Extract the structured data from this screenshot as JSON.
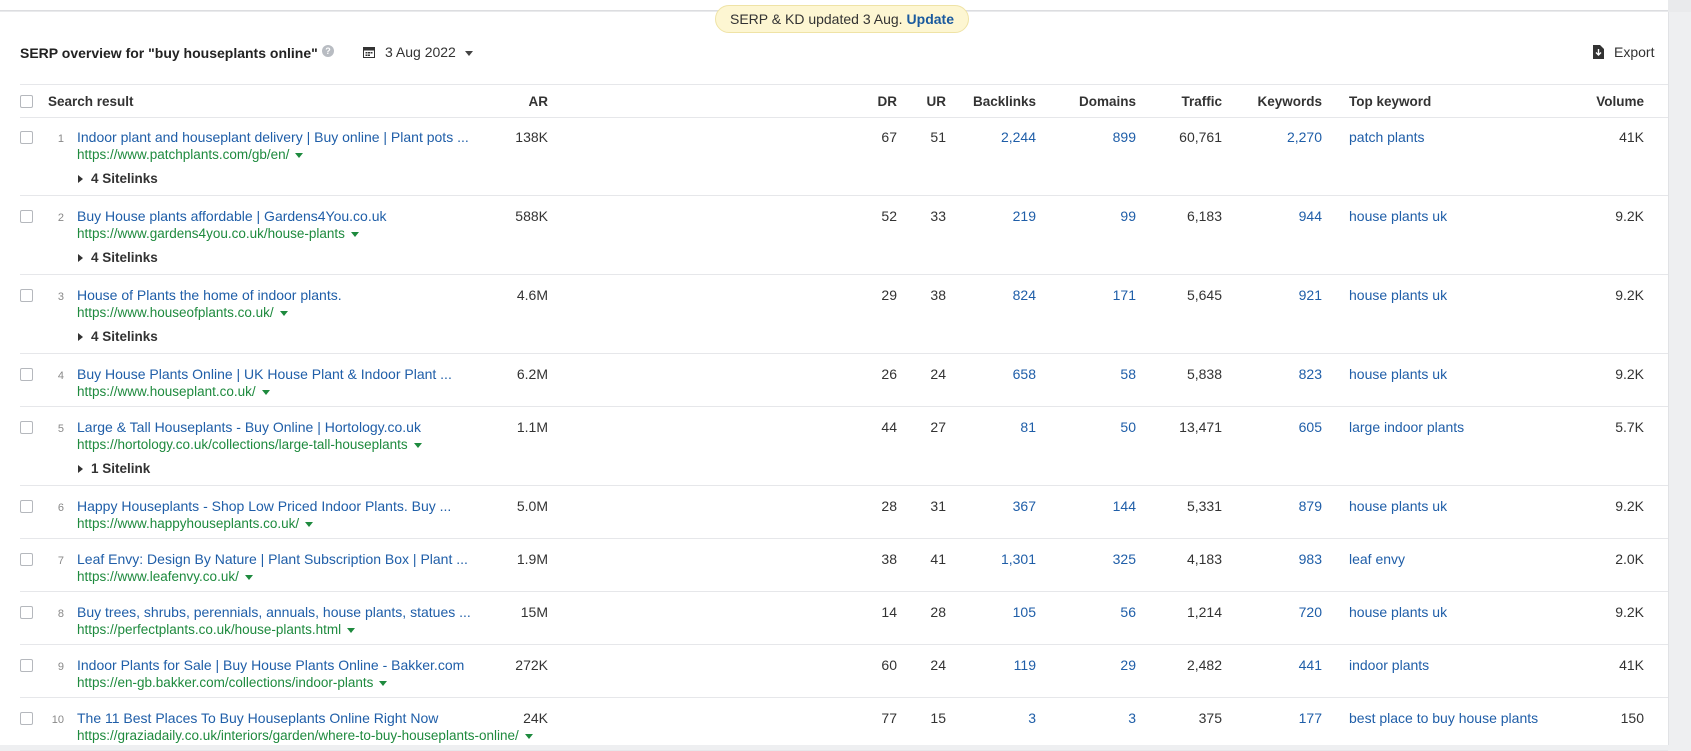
{
  "banner": {
    "text": "SERP & KD updated 3 Aug.",
    "link": "Update"
  },
  "header": {
    "title": "SERP overview for \"buy houseplants online\"",
    "date": "3 Aug 2022",
    "export": "Export"
  },
  "columns": {
    "search_result": "Search result",
    "ar": "AR",
    "dr": "DR",
    "ur": "UR",
    "backlinks": "Backlinks",
    "domains": "Domains",
    "traffic": "Traffic",
    "keywords": "Keywords",
    "top_keyword": "Top keyword",
    "volume": "Volume"
  },
  "rows": [
    {
      "idx": "1",
      "title": "Indoor plant and houseplant delivery | Buy online | Plant pots ...",
      "url": "https://www.patchplants.com/gb/en/",
      "sitelinks": "4 Sitelinks",
      "ar": "138K",
      "dr": "67",
      "ur": "51",
      "backlinks": "2,244",
      "domains": "899",
      "traffic": "60,761",
      "keywords": "2,270",
      "top_keyword": "patch plants",
      "volume": "41K"
    },
    {
      "idx": "2",
      "title": "Buy House plants affordable | Gardens4You.co.uk",
      "url": "https://www.gardens4you.co.uk/house-plants",
      "sitelinks": "4 Sitelinks",
      "ar": "588K",
      "dr": "52",
      "ur": "33",
      "backlinks": "219",
      "domains": "99",
      "traffic": "6,183",
      "keywords": "944",
      "top_keyword": "house plants uk",
      "volume": "9.2K"
    },
    {
      "idx": "3",
      "title": "House of Plants the home of indoor plants.",
      "url": "https://www.houseofplants.co.uk/",
      "sitelinks": "4 Sitelinks",
      "ar": "4.6M",
      "dr": "29",
      "ur": "38",
      "backlinks": "824",
      "domains": "171",
      "traffic": "5,645",
      "keywords": "921",
      "top_keyword": "house plants uk",
      "volume": "9.2K"
    },
    {
      "idx": "4",
      "title": "Buy House Plants Online | UK House Plant & Indoor Plant ...",
      "url": "https://www.houseplant.co.uk/",
      "sitelinks": "",
      "ar": "6.2M",
      "dr": "26",
      "ur": "24",
      "backlinks": "658",
      "domains": "58",
      "traffic": "5,838",
      "keywords": "823",
      "top_keyword": "house plants uk",
      "volume": "9.2K"
    },
    {
      "idx": "5",
      "title": "Large & Tall Houseplants - Buy Online | Hortology.co.uk",
      "url": "https://hortology.co.uk/collections/large-tall-houseplants",
      "sitelinks": "1 Sitelink",
      "ar": "1.1M",
      "dr": "44",
      "ur": "27",
      "backlinks": "81",
      "domains": "50",
      "traffic": "13,471",
      "keywords": "605",
      "top_keyword": "large indoor plants",
      "volume": "5.7K"
    },
    {
      "idx": "6",
      "title": "Happy Houseplants - Shop Low Priced Indoor Plants. Buy ...",
      "url": "https://www.happyhouseplants.co.uk/",
      "sitelinks": "",
      "ar": "5.0M",
      "dr": "28",
      "ur": "31",
      "backlinks": "367",
      "domains": "144",
      "traffic": "5,331",
      "keywords": "879",
      "top_keyword": "house plants uk",
      "volume": "9.2K"
    },
    {
      "idx": "7",
      "title": "Leaf Envy: Design By Nature | Plant Subscription Box | Plant ...",
      "url": "https://www.leafenvy.co.uk/",
      "sitelinks": "",
      "ar": "1.9M",
      "dr": "38",
      "ur": "41",
      "backlinks": "1,301",
      "domains": "325",
      "traffic": "4,183",
      "keywords": "983",
      "top_keyword": "leaf envy",
      "volume": "2.0K"
    },
    {
      "idx": "8",
      "title": "Buy trees, shrubs, perennials, annuals, house plants, statues ...",
      "url": "https://perfectplants.co.uk/house-plants.html",
      "sitelinks": "",
      "ar": "15M",
      "dr": "14",
      "ur": "28",
      "backlinks": "105",
      "domains": "56",
      "traffic": "1,214",
      "keywords": "720",
      "top_keyword": "house plants uk",
      "volume": "9.2K"
    },
    {
      "idx": "9",
      "title": "Indoor Plants for Sale | Buy House Plants Online - Bakker.com",
      "url": "https://en-gb.bakker.com/collections/indoor-plants",
      "sitelinks": "",
      "ar": "272K",
      "dr": "60",
      "ur": "24",
      "backlinks": "119",
      "domains": "29",
      "traffic": "2,482",
      "keywords": "441",
      "top_keyword": "indoor plants",
      "volume": "41K"
    },
    {
      "idx": "10",
      "title": "The 11 Best Places To Buy Houseplants Online Right Now",
      "url": "https://graziadaily.co.uk/interiors/garden/where-to-buy-houseplants-online/",
      "sitelinks": "",
      "ar": "24K",
      "dr": "77",
      "ur": "15",
      "backlinks": "3",
      "domains": "3",
      "traffic": "375",
      "keywords": "177",
      "top_keyword": "best place to buy house plants",
      "volume": "150"
    }
  ]
}
